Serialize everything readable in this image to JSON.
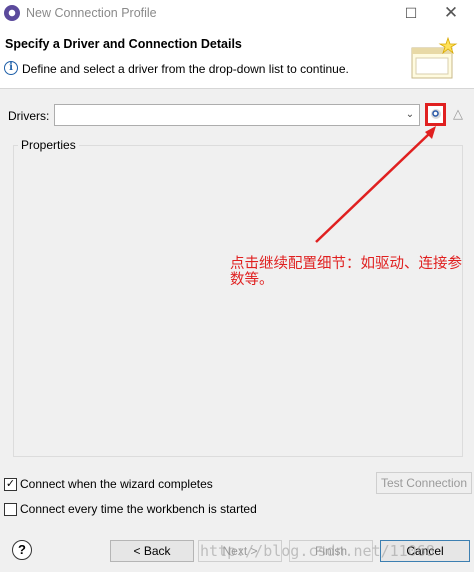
{
  "window": {
    "title": "New Connection Profile",
    "maximize_glyph": "☐",
    "close_glyph": "✕"
  },
  "header": {
    "title": "Specify a Driver and Connection Details",
    "description": "Define and select a driver from the drop-down list to continue.",
    "info_icon": "i"
  },
  "drivers": {
    "label": "Drivers:",
    "value": "",
    "edit_glyph": "△"
  },
  "properties": {
    "label": "Properties"
  },
  "annotation": {
    "text": "点击继续配置细节：如驱动、连接参数等。",
    "color": "#e02020"
  },
  "options": {
    "connect_wizard_label": "Connect when the wizard completes",
    "connect_wizard_checked": true,
    "connect_workbench_label": "Connect every time the workbench is started",
    "connect_workbench_checked": false
  },
  "buttons": {
    "test_connection": "Test Connection",
    "back": "< Back",
    "next": "Next >",
    "finish": "Finish",
    "cancel": "Cancel",
    "help": "?"
  },
  "watermark": "http://blog.csdn.net/11068"
}
